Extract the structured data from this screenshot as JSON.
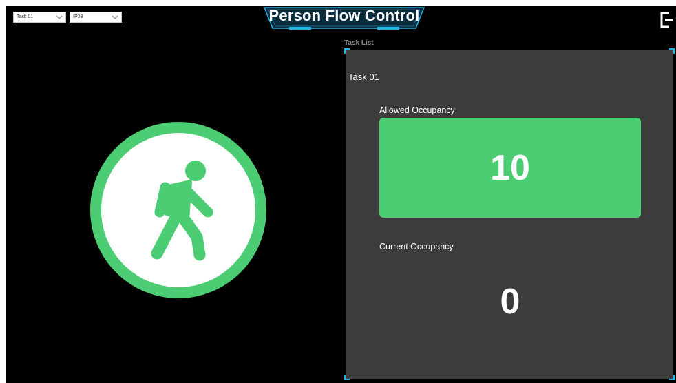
{
  "filters": {
    "task_select": "Task 01",
    "device_select": "IP03"
  },
  "header": {
    "title": "Person Flow Control"
  },
  "status": {
    "icon": "person-walking-icon",
    "color": "#4ccc73"
  },
  "task_list": {
    "label": "Task List",
    "task_name": "Task 01",
    "allowed_occupancy_label": "Allowed Occupancy",
    "allowed_occupancy_value": "10",
    "current_occupancy_label": "Current Occupancy",
    "current_occupancy_value": "0"
  },
  "colors": {
    "accent": "#1fb4e6",
    "status_green": "#4ccc73",
    "panel": "#3c3c3c"
  }
}
